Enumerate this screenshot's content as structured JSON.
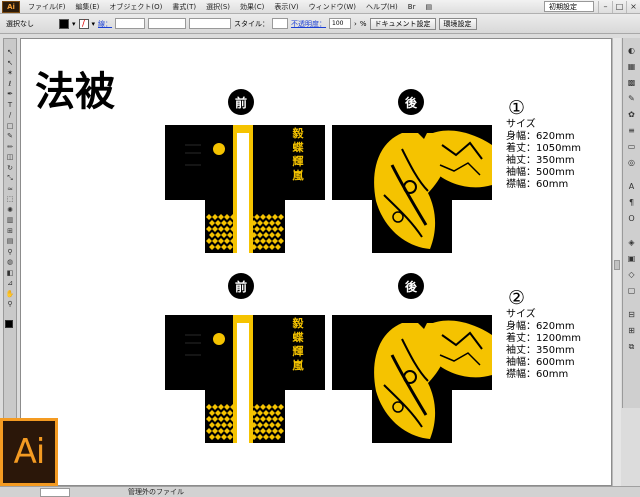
{
  "menubar": {
    "app_logo": "Ai",
    "items": [
      "ファイル(F)",
      "編集(E)",
      "オブジェクト(O)",
      "書式(T)",
      "選択(S)",
      "効果(C)",
      "表示(V)",
      "ウィンドウ(W)",
      "ヘルプ(H)"
    ],
    "workspace": "初期設定"
  },
  "control_bar": {
    "selection_status": "選択なし",
    "stroke_label": "線：",
    "style_label": "スタイル：",
    "opacity_label": "不透明度：",
    "opacity_value": "100",
    "opacity_unit": "%",
    "doc_settings": "ドキュメント設定",
    "prefs": "環境設定"
  },
  "statusbar": {
    "text": "管理外のファイル"
  },
  "artwork": {
    "title": "法被",
    "front_label": "前",
    "back_label": "後",
    "collar_text": "毅蝶輝嵐",
    "colors": {
      "accent": "#f5c300",
      "black": "#000000"
    },
    "specs": [
      {
        "number": "①",
        "heading": "サイズ",
        "lines": [
          "身幅：620mm",
          "着丈：1050mm",
          "袖丈：350mm",
          "袖幅：500mm",
          "襟幅：60mm"
        ]
      },
      {
        "number": "②",
        "heading": "サイズ",
        "lines": [
          "身幅：620mm",
          "着丈：1200mm",
          "袖丈：350mm",
          "袖幅：600mm",
          "襟幅：60mm"
        ]
      }
    ]
  },
  "icons": [
    "selection-icon",
    "direct-selection-icon",
    "magic-wand-icon",
    "lasso-icon",
    "pen-icon",
    "type-icon",
    "line-icon",
    "rectangle-icon",
    "paintbrush-icon",
    "pencil-icon",
    "eraser-icon",
    "rotate-icon",
    "scale-icon",
    "warp-icon",
    "free-transform-icon",
    "symbol-sprayer-icon",
    "graph-icon",
    "mesh-icon",
    "gradient-icon",
    "eyedropper-icon",
    "blend-icon",
    "live-paint-icon",
    "slice-icon",
    "hand-icon",
    "zoom-icon"
  ]
}
